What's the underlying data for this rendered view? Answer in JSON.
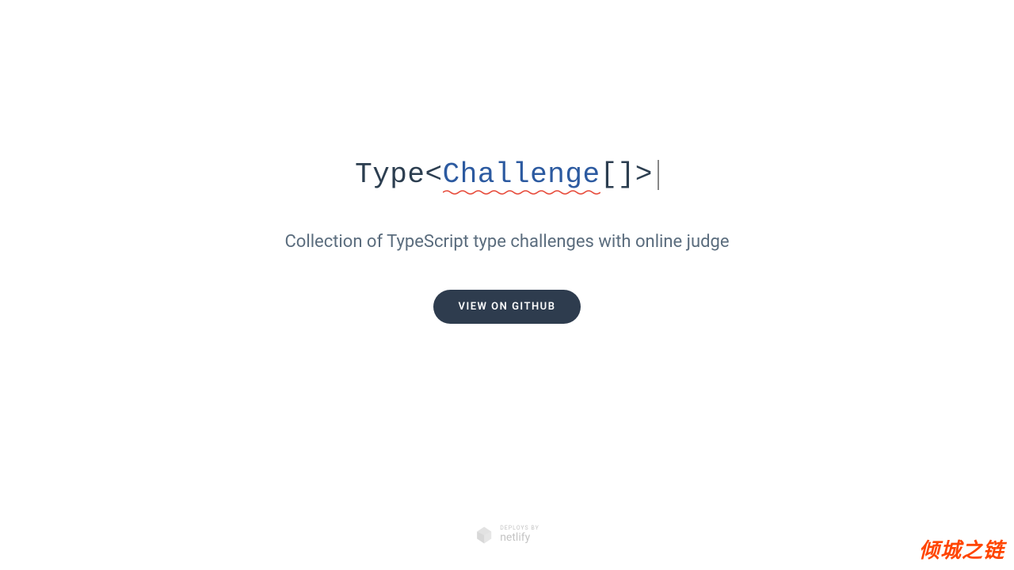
{
  "logo": {
    "type": "Type",
    "open": "<",
    "challenge": "Challenge",
    "array": "[]",
    "close": ">"
  },
  "subtitle": "Collection of TypeScript type challenges with online judge",
  "button": {
    "github": "VIEW ON GITHUB"
  },
  "netlify": {
    "deploys": "DEPLOYS BY",
    "name": "netlify"
  },
  "watermark": "倾城之链"
}
